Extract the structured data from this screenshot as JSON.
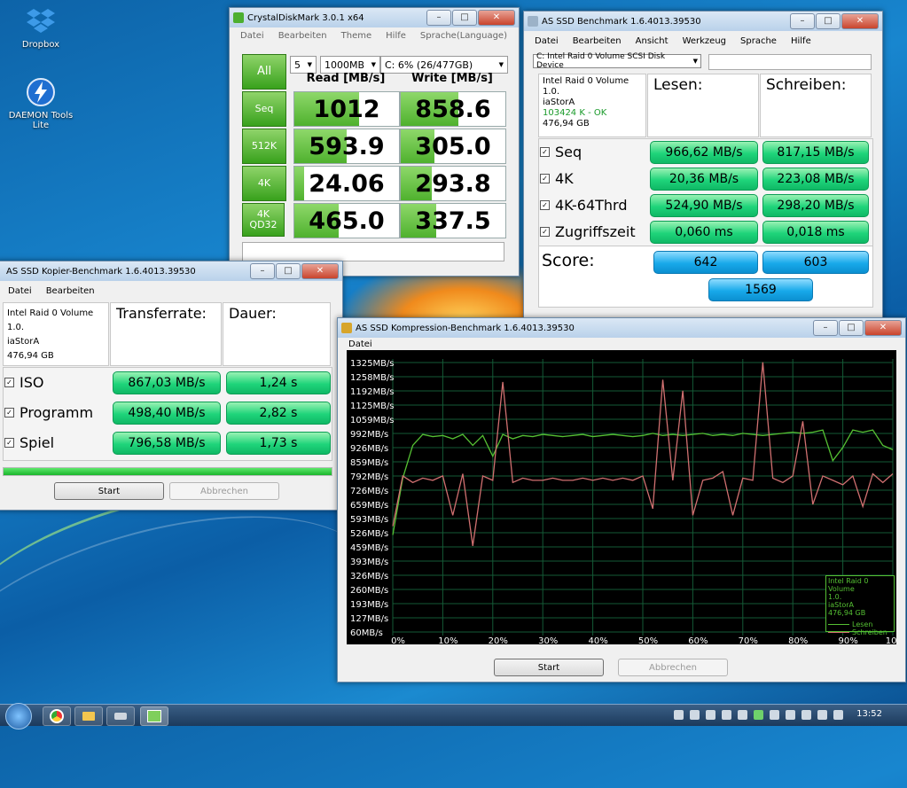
{
  "desktop": {
    "icons": [
      {
        "label": "Dropbox",
        "icon": "dropbox-icon"
      },
      {
        "label": "DAEMON Tools Lite",
        "icon": "daemon-tools-icon"
      }
    ]
  },
  "cdm": {
    "title": "CrystalDiskMark 3.0.1 x64",
    "menu": [
      "Datei",
      "Bearbeiten",
      "Theme",
      "Hilfe",
      "Sprache(Language)"
    ],
    "all_label": "All",
    "count": "5",
    "size": "1000MB",
    "drive": "C: 6% (26/477GB)",
    "read_header": "Read [MB/s]",
    "write_header": "Write [MB/s]",
    "rows": [
      {
        "label": "Seq",
        "read": "1012",
        "write": "858.6",
        "read_fill": 0.62,
        "write_fill": 0.55
      },
      {
        "label": "512K",
        "read": "593.9",
        "write": "305.0",
        "read_fill": 0.5,
        "write_fill": 0.32
      },
      {
        "label": "4K",
        "read": "24.06",
        "write": "293.8",
        "read_fill": 0.09,
        "write_fill": 0.3
      },
      {
        "label": "4K QD32",
        "read": "465.0",
        "write": "337.5",
        "read_fill": 0.42,
        "write_fill": 0.34
      }
    ]
  },
  "asssd": {
    "title": "AS SSD Benchmark 1.6.4013.39530",
    "menu": [
      "Datei",
      "Bearbeiten",
      "Ansicht",
      "Werkzeug",
      "Sprache",
      "Hilfe"
    ],
    "device": "C: Intel Raid 0 Volume SCSI Disk Device",
    "info": [
      "Intel Raid 0 Volume",
      "1.0.",
      "iaStorA",
      "103424 K - OK",
      "476,94 GB"
    ],
    "read_header": "Lesen:",
    "write_header": "Schreiben:",
    "rows": [
      {
        "label": "Seq",
        "read": "966,62 MB/s",
        "write": "817,15 MB/s"
      },
      {
        "label": "4K",
        "read": "20,36 MB/s",
        "write": "223,08 MB/s"
      },
      {
        "label": "4K-64Thrd",
        "read": "524,90 MB/s",
        "write": "298,20 MB/s"
      },
      {
        "label": "Zugriffszeit",
        "read": "0,060 ms",
        "write": "0,018 ms"
      }
    ],
    "score_label": "Score:",
    "score_read": "642",
    "score_write": "603",
    "score_total": "1569"
  },
  "copy": {
    "title": "AS SSD Kopier-Benchmark 1.6.4013.39530",
    "menu": [
      "Datei",
      "Bearbeiten"
    ],
    "info": [
      "Intel Raid 0 Volume",
      "1.0.",
      "iaStorA",
      "476,94 GB"
    ],
    "rate_header": "Transferrate:",
    "time_header": "Dauer:",
    "rows": [
      {
        "label": "ISO",
        "rate": "867,03 MB/s",
        "time": "1,24 s"
      },
      {
        "label": "Programm",
        "rate": "498,40 MB/s",
        "time": "2,82 s"
      },
      {
        "label": "Spiel",
        "rate": "796,58 MB/s",
        "time": "1,73 s"
      }
    ],
    "progress": 1.0,
    "start_label": "Start",
    "cancel_label": "Abbrechen"
  },
  "compress": {
    "title": "AS SSD Kompression-Benchmark 1.6.4013.39530",
    "menu": [
      "Datei"
    ],
    "legend_info": [
      "Intel Raid 0 Volume",
      "1.0.",
      "iaStorA",
      "476,94 GB"
    ],
    "start_label": "Start",
    "cancel_label": "Abbrechen"
  },
  "chart_data": {
    "type": "line",
    "xlabel": "",
    "ylabel": "",
    "x_ticks": [
      "0%",
      "10%",
      "20%",
      "30%",
      "40%",
      "50%",
      "60%",
      "70%",
      "80%",
      "90%",
      "100%"
    ],
    "y_ticks": [
      "1325MB/s",
      "1258MB/s",
      "1192MB/s",
      "1125MB/s",
      "1059MB/s",
      "992MB/s",
      "926MB/s",
      "859MB/s",
      "792MB/s",
      "726MB/s",
      "659MB/s",
      "593MB/s",
      "526MB/s",
      "459MB/s",
      "393MB/s",
      "326MB/s",
      "260MB/s",
      "193MB/s",
      "127MB/s",
      "60MB/s"
    ],
    "ylim": [
      60,
      1325
    ],
    "xlim": [
      0,
      100
    ],
    "grid": true,
    "legend_position": "bottom-right",
    "colors": {
      "Lesen": "#55c033",
      "Schreiben": "#d07070",
      "grid": "#145a36"
    },
    "series": [
      {
        "name": "Lesen",
        "x": [
          0,
          2,
          4,
          6,
          8,
          10,
          12,
          14,
          16,
          18,
          20,
          22,
          24,
          26,
          28,
          30,
          32,
          34,
          36,
          38,
          40,
          42,
          44,
          46,
          48,
          50,
          52,
          54,
          56,
          58,
          60,
          62,
          64,
          66,
          68,
          70,
          72,
          74,
          76,
          78,
          80,
          82,
          84,
          86,
          88,
          90,
          92,
          94,
          96,
          98,
          100
        ],
        "y": [
          520,
          780,
          930,
          980,
          970,
          975,
          960,
          980,
          930,
          975,
          880,
          980,
          960,
          975,
          970,
          980,
          975,
          970,
          975,
          980,
          970,
          975,
          980,
          975,
          970,
          975,
          985,
          975,
          980,
          975,
          980,
          985,
          975,
          980,
          975,
          985,
          980,
          975,
          980,
          985,
          990,
          985,
          990,
          1000,
          860,
          920,
          1000,
          990,
          1000,
          930,
          910
        ]
      },
      {
        "name": "Schreiben",
        "x": [
          0,
          2,
          4,
          6,
          8,
          10,
          12,
          14,
          16,
          18,
          20,
          22,
          24,
          26,
          28,
          30,
          32,
          34,
          36,
          38,
          40,
          42,
          44,
          46,
          48,
          50,
          52,
          54,
          56,
          58,
          60,
          62,
          64,
          66,
          68,
          70,
          72,
          74,
          76,
          78,
          80,
          82,
          84,
          86,
          88,
          90,
          92,
          94,
          96,
          98,
          100
        ],
        "y": [
          560,
          790,
          760,
          780,
          770,
          790,
          610,
          800,
          470,
          790,
          770,
          1220,
          760,
          780,
          770,
          770,
          780,
          770,
          770,
          780,
          770,
          780,
          770,
          780,
          770,
          790,
          640,
          1230,
          770,
          1180,
          610,
          770,
          780,
          810,
          610,
          780,
          770,
          1310,
          780,
          760,
          790,
          1040,
          660,
          790,
          770,
          750,
          790,
          650,
          800,
          760,
          800
        ]
      }
    ]
  },
  "taskbar": {
    "clock": "13:52"
  }
}
